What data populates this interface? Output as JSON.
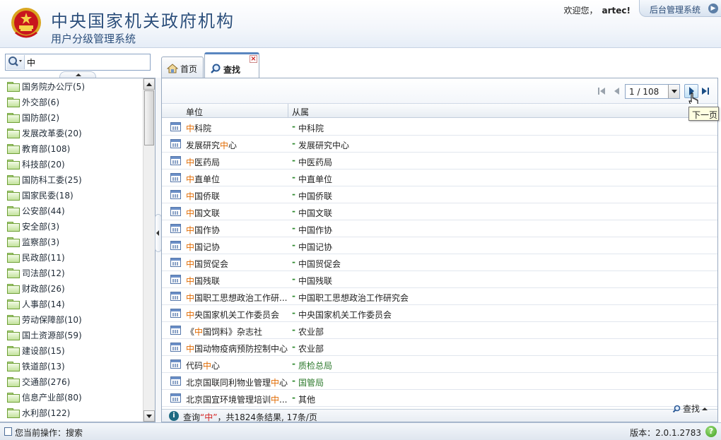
{
  "header": {
    "title": "中央国家机关政府机构",
    "subtitle": "用户分级管理系统",
    "welcome_prefix": "欢迎您，",
    "username": "artec!",
    "admin_button": "后台管理系统"
  },
  "search": {
    "value": "中"
  },
  "tree": {
    "items": [
      "国务院办公厅(5)",
      "外交部(6)",
      "国防部(2)",
      "发展改革委(20)",
      "教育部(108)",
      "科技部(20)",
      "国防科工委(25)",
      "国家民委(18)",
      "公安部(44)",
      "安全部(3)",
      "监察部(3)",
      "民政部(11)",
      "司法部(12)",
      "财政部(26)",
      "人事部(14)",
      "劳动保障部(10)",
      "国土资源部(59)",
      "建设部(15)",
      "铁道部(13)",
      "交通部(276)",
      "信息产业部(80)",
      "水利部(122)"
    ]
  },
  "tabs": {
    "home": "首页",
    "find": "查找"
  },
  "pager": {
    "page_display": "1 / 108",
    "next_tooltip": "下一页"
  },
  "grid": {
    "col_unit": "单位",
    "col_parent": "从属",
    "rows": [
      {
        "pre": "",
        "hl": "中",
        "post": "科院",
        "parent": "中科院"
      },
      {
        "pre": "发展研究",
        "hl": "中",
        "post": "心",
        "parent": "发展研究中心"
      },
      {
        "pre": "",
        "hl": "中",
        "post": "医药局",
        "parent": "中医药局"
      },
      {
        "pre": "",
        "hl": "中",
        "post": "直单位",
        "parent": "中直单位"
      },
      {
        "pre": "",
        "hl": "中",
        "post": "国侨联",
        "parent": "中国侨联"
      },
      {
        "pre": "",
        "hl": "中",
        "post": "国文联",
        "parent": "中国文联"
      },
      {
        "pre": "",
        "hl": "中",
        "post": "国作协",
        "parent": "中国作协"
      },
      {
        "pre": "",
        "hl": "中",
        "post": "国记协",
        "parent": "中国记协"
      },
      {
        "pre": "",
        "hl": "中",
        "post": "国贸促会",
        "parent": "中国贸促会"
      },
      {
        "pre": "",
        "hl": "中",
        "post": "国残联",
        "parent": "中国残联"
      },
      {
        "pre": "",
        "hl": "中",
        "post": "国职工思想政治工作研...",
        "parent": "中国职工思想政治工作研究会"
      },
      {
        "pre": "",
        "hl": "中",
        "post": "央国家机关工作委员会",
        "parent": "中央国家机关工作委员会"
      },
      {
        "pre": "《",
        "hl": "中",
        "post": "国饲料》杂志社",
        "parent": "农业部"
      },
      {
        "pre": "",
        "hl": "中",
        "post": "国动物疫病预防控制中心",
        "parent": "农业部"
      },
      {
        "pre": "代码",
        "hl": "中",
        "post": "心",
        "parent": "质检总局",
        "green": true
      },
      {
        "pre": "北京国联同利物业管理",
        "hl": "中",
        "post": "心",
        "parent": "国管局",
        "green": true
      },
      {
        "pre": "北京国宜环境管理培训",
        "hl": "中",
        "post": "...",
        "parent": "其他"
      }
    ]
  },
  "result": {
    "prefix": "查询",
    "query": "“中”",
    "suffix": "，共1824条结果, 17条/页"
  },
  "find_link": "查找",
  "statusbar": {
    "current_op": "您当前操作：搜索",
    "version": "版本：2.0.1.2783"
  },
  "colors": {
    "accent": "#2c4f7c",
    "highlight": "#e06a00",
    "border": "#99aac0"
  }
}
